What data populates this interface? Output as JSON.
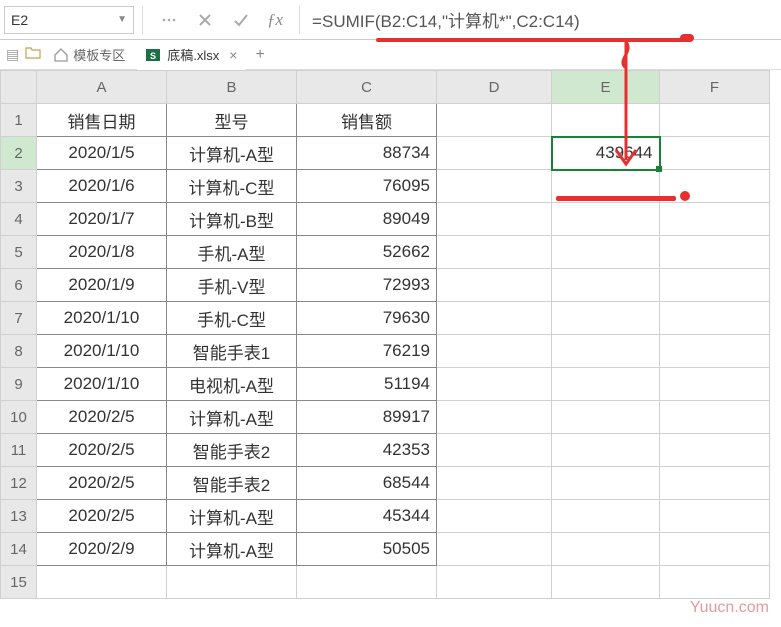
{
  "namebox": "E2",
  "formula": "=SUMIF(B2:C14,\"计算机*\",C2:C14)",
  "tabs": {
    "template": "模板专区",
    "file": "底稿.xlsx"
  },
  "columns": [
    "A",
    "B",
    "C",
    "D",
    "E",
    "F"
  ],
  "rows": [
    "1",
    "2",
    "3",
    "4",
    "5",
    "6",
    "7",
    "8",
    "9",
    "10",
    "11",
    "12",
    "13",
    "14",
    "15"
  ],
  "headers": {
    "A": "销售日期",
    "B": "型号",
    "C": "销售额"
  },
  "data": [
    {
      "date": "2020/1/5",
      "model": "计算机-A型",
      "sales": "88734"
    },
    {
      "date": "2020/1/6",
      "model": "计算机-C型",
      "sales": "76095"
    },
    {
      "date": "2020/1/7",
      "model": "计算机-B型",
      "sales": "89049"
    },
    {
      "date": "2020/1/8",
      "model": "手机-A型",
      "sales": "52662"
    },
    {
      "date": "2020/1/9",
      "model": "手机-V型",
      "sales": "72993"
    },
    {
      "date": "2020/1/10",
      "model": "手机-C型",
      "sales": "79630"
    },
    {
      "date": "2020/1/10",
      "model": "智能手表1",
      "sales": "76219"
    },
    {
      "date": "2020/1/10",
      "model": "电视机-A型",
      "sales": "51194"
    },
    {
      "date": "2020/2/5",
      "model": "计算机-A型",
      "sales": "89917"
    },
    {
      "date": "2020/2/5",
      "model": "智能手表2",
      "sales": "42353"
    },
    {
      "date": "2020/2/5",
      "model": "智能手表2",
      "sales": "68544"
    },
    {
      "date": "2020/2/5",
      "model": "计算机-A型",
      "sales": "45344"
    },
    {
      "date": "2020/2/9",
      "model": "计算机-A型",
      "sales": "50505"
    }
  ],
  "result": "439644",
  "watermark": "Yuucn.com"
}
